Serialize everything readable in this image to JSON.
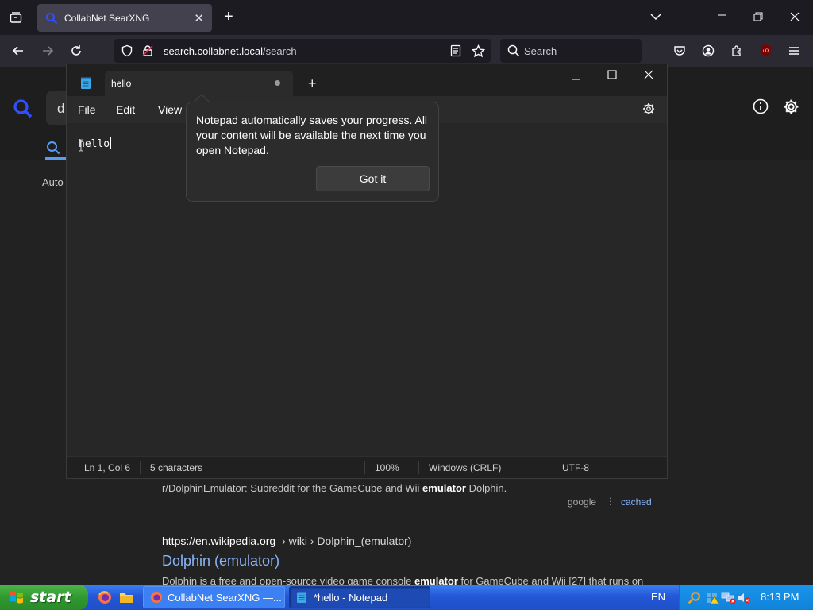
{
  "browser": {
    "tab_title": "CollabNet SearXNG",
    "url_host": "search.collabnet.local",
    "url_path": "/search",
    "search_placeholder": "Search"
  },
  "page": {
    "query_partial": "d",
    "autocomplete_partial": "Auto-",
    "result1_snippet": "r/DolphinEmulator: Subreddit for the GameCube and Wii ",
    "result1_snippet_bold": "emulator",
    "result1_snippet_tail": " Dolphin.",
    "result1_engine": "google",
    "result1_cached": "cached",
    "result2_url_host": "https://en.wikipedia.org",
    "result2_url_path": " › wiki › Dolphin_(emulator)",
    "result2_title": "Dolphin (emulator)",
    "result2_snippet_start": "Dolphin is a free and open-source video game console ",
    "result2_snippet_bold": "emulator",
    "result2_snippet_tail": " for GameCube and Wii [27] that runs on"
  },
  "notepad": {
    "tab_title": "hello",
    "menu": {
      "file": "File",
      "edit": "Edit",
      "view": "View"
    },
    "content": "hello",
    "status": {
      "position": "Ln 1, Col 6",
      "chars": "5 characters",
      "zoom": "100%",
      "line_ending": "Windows (CRLF)",
      "encoding": "UTF-8"
    }
  },
  "tip": {
    "text": "Notepad automatically saves your progress. All your content will be available the next time you open Notepad.",
    "button": "Got it"
  },
  "taskbar": {
    "start": "start",
    "task_firefox": "CollabNet SearXNG —...",
    "task_notepad": "*hello - Notepad",
    "lang": "EN",
    "clock": "8:13 PM"
  },
  "colors": {
    "start_green": "#2f9a2f",
    "taskbar_blue": "#2458d6",
    "link_blue": "#8ab4f8"
  }
}
